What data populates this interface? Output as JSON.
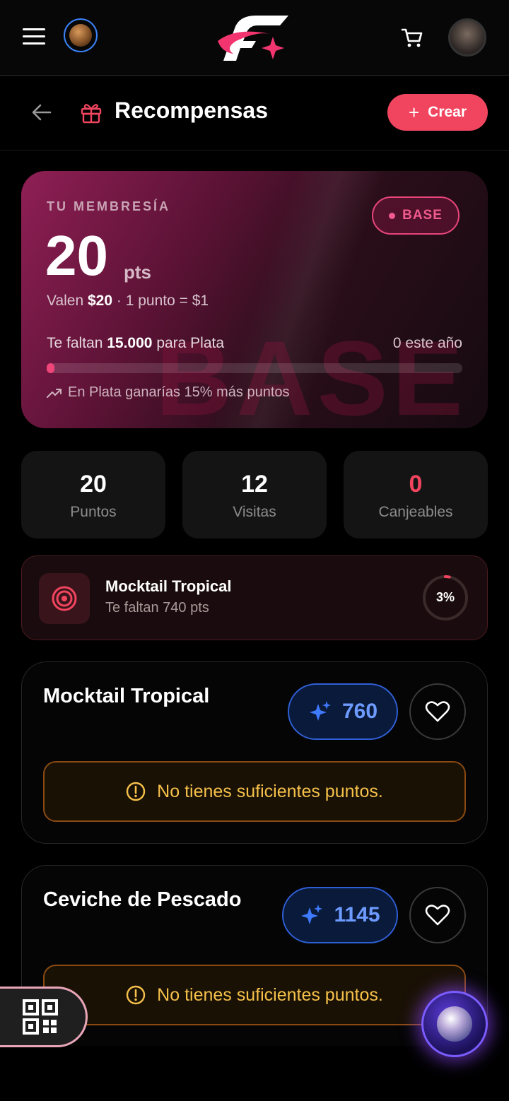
{
  "nav": {
    "menu_icon": "hamburger-icon",
    "planet_icon": "planet-icon",
    "logo": "brand-logo",
    "cart_icon": "cart-icon",
    "avatar": "user-avatar"
  },
  "header": {
    "title": "Recompensas",
    "create_label": "Crear"
  },
  "membership": {
    "label": "TU MEMBRESÍA",
    "tier": "BASE",
    "points": "20",
    "points_unit": "pts",
    "value_prefix": "Valen",
    "value_amount": "$20",
    "value_suffix": "· 1 punto = $1",
    "missing_prefix": "Te faltan",
    "missing_amount": "15.000",
    "missing_suffix": "para Plata",
    "this_year": "0 este año",
    "progress_fraction": 0.0013,
    "hint": "En Plata ganarías 15% más puntos",
    "watermark": "BASE"
  },
  "stats": [
    {
      "value": "20",
      "label": "Puntos",
      "color": "#ffffff"
    },
    {
      "value": "12",
      "label": "Visitas",
      "color": "#ffffff"
    },
    {
      "value": "0",
      "label": "Canjeables",
      "color": "#f1455f"
    }
  ],
  "next_reward": {
    "name": "Mocktail Tropical",
    "detail": "Te faltan 740 pts",
    "percent": "3%",
    "progress": 0.03
  },
  "rewards": [
    {
      "name": "Mocktail Tropical",
      "cost": "760",
      "warning": "No tienes suficientes puntos."
    },
    {
      "name": "Ceviche de Pescado",
      "cost": "1145",
      "warning": "No tienes suficientes puntos."
    }
  ],
  "colors": {
    "accent": "#f1455f",
    "tier": "#f25b8d",
    "cost": "#6d9bff",
    "warning": "#f5c14a"
  }
}
